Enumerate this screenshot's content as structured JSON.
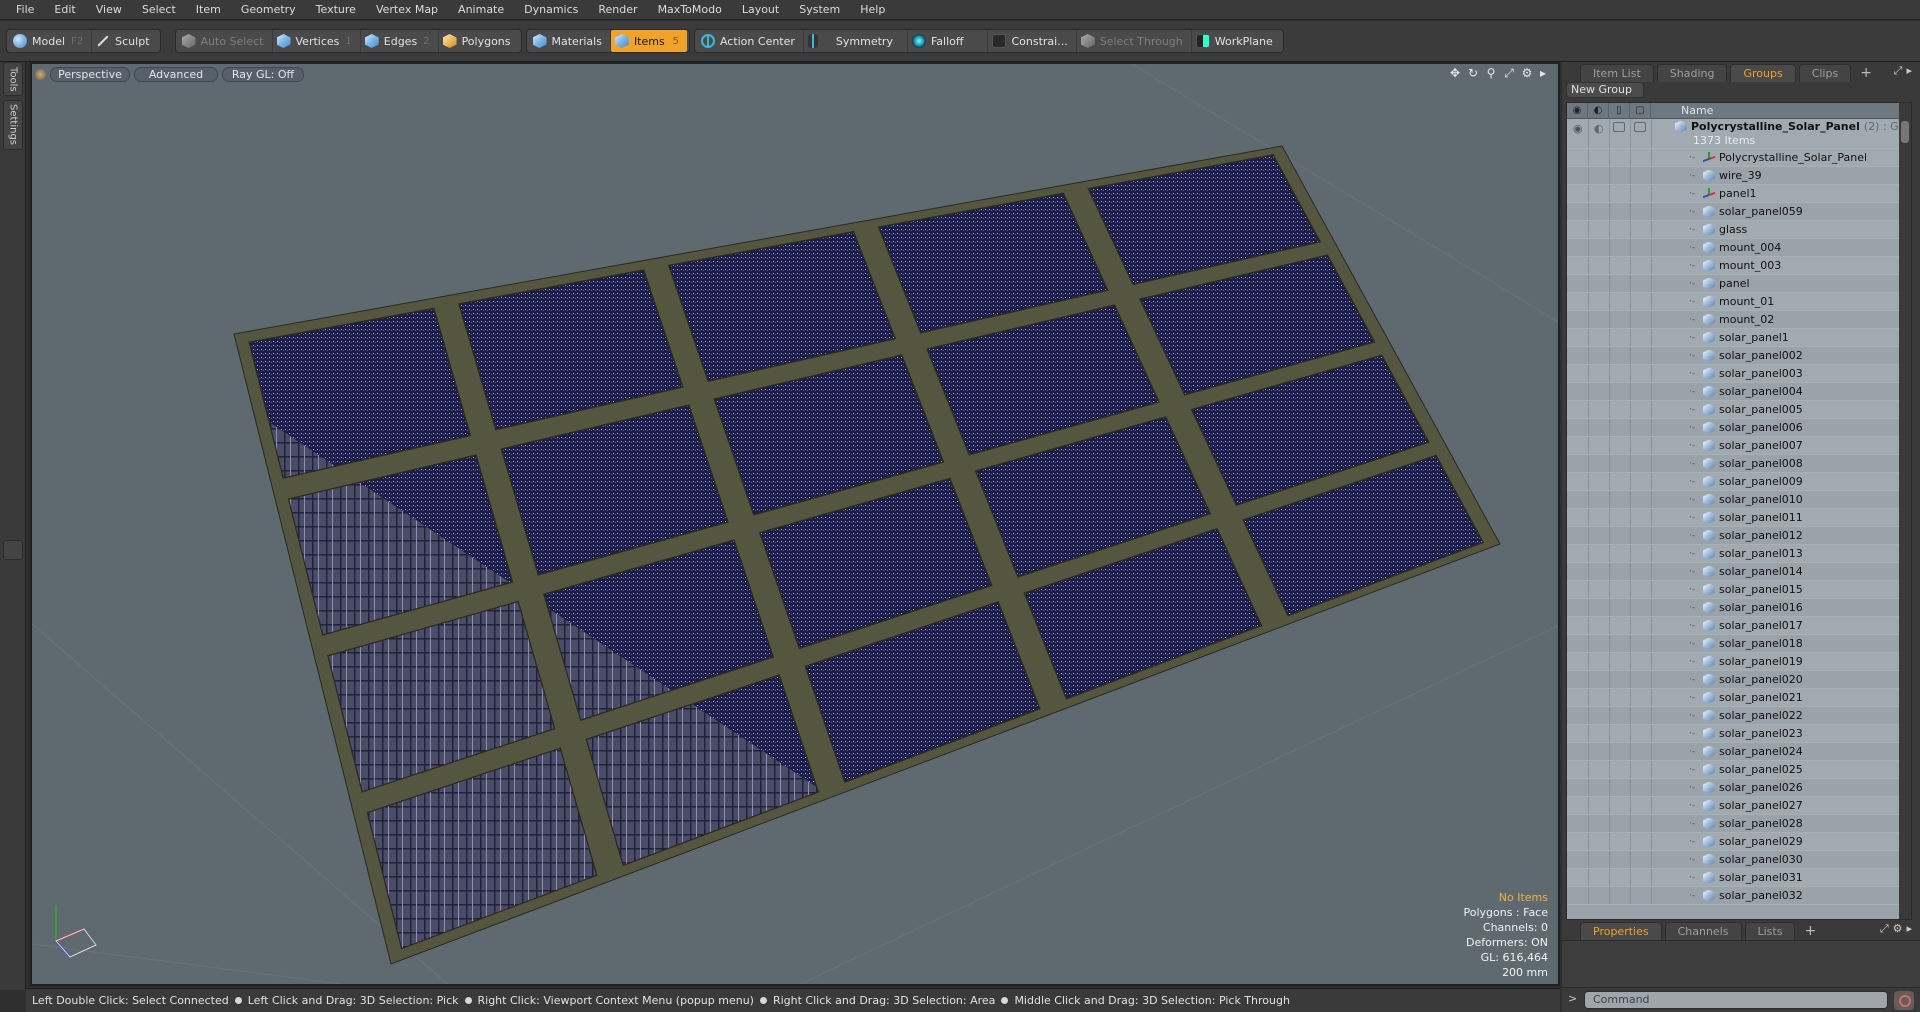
{
  "menu": [
    "File",
    "Edit",
    "View",
    "Select",
    "Item",
    "Geometry",
    "Texture",
    "Vertex Map",
    "Animate",
    "Dynamics",
    "Render",
    "MaxToModo",
    "Layout",
    "System",
    "Help"
  ],
  "toolbar": {
    "model": {
      "label": "Model",
      "key": "F2"
    },
    "sculpt": {
      "label": "Sculpt"
    },
    "auto_select": {
      "label": "Auto Select"
    },
    "vertices": {
      "label": "Vertices",
      "key": "1"
    },
    "edges": {
      "label": "Edges",
      "key": "2"
    },
    "polygons": {
      "label": "Polygons"
    },
    "materials": {
      "label": "Materials"
    },
    "items": {
      "label": "Items",
      "key": "5"
    },
    "action_center": {
      "label": "Action Center"
    },
    "symmetry": {
      "label": "Symmetry"
    },
    "falloff": {
      "label": "Falloff"
    },
    "constraints": {
      "label": "Constrai..."
    },
    "select_through": {
      "label": "Select Through"
    },
    "workplane": {
      "label": "WorkPlane"
    }
  },
  "side_tabs": {
    "tools": "Tools",
    "settings": "Settings"
  },
  "viewport": {
    "view_mode": "Perspective",
    "shading": "Advanced",
    "raygl": "Ray GL: Off",
    "accent_color": "#f0a22a",
    "panel_color": "#1c1c48",
    "info": {
      "selection": "No Items",
      "polygons": "Polygons : Face",
      "channels": "Channels: 0",
      "deformers": "Deformers: ON",
      "gl": "GL: 616,464",
      "scale": "200 mm"
    }
  },
  "status_bar": [
    "Left Double Click: Select Connected",
    "Left Click and Drag: 3D Selection: Pick",
    "Right Click: Viewport Context Menu (popup menu)",
    "Right Click and Drag: 3D Selection: Area",
    "Middle Click and Drag: 3D Selection: Pick Through"
  ],
  "right_panel": {
    "top_tabs": [
      "Item List",
      "Shading",
      "Groups",
      "Clips"
    ],
    "active_top_tab": "Groups",
    "new_group_label": "New Group",
    "column_name": "Name",
    "group": {
      "name": "Polycrystalline_Solar_Panel",
      "suffix": "(2) : G...",
      "count": "1373 Items"
    },
    "items": [
      {
        "name": "Polycrystalline_Solar_Panel",
        "type": "locator"
      },
      {
        "name": "wire_39",
        "type": "mesh"
      },
      {
        "name": "panel1",
        "type": "locator"
      },
      {
        "name": "solar_panel059",
        "type": "mesh"
      },
      {
        "name": "glass",
        "type": "mesh"
      },
      {
        "name": "mount_004",
        "type": "mesh"
      },
      {
        "name": "mount_003",
        "type": "mesh"
      },
      {
        "name": "panel",
        "type": "mesh"
      },
      {
        "name": "mount_01",
        "type": "mesh"
      },
      {
        "name": "mount_02",
        "type": "mesh"
      },
      {
        "name": "solar_panel1",
        "type": "mesh"
      },
      {
        "name": "solar_panel002",
        "type": "mesh"
      },
      {
        "name": "solar_panel003",
        "type": "mesh"
      },
      {
        "name": "solar_panel004",
        "type": "mesh"
      },
      {
        "name": "solar_panel005",
        "type": "mesh"
      },
      {
        "name": "solar_panel006",
        "type": "mesh"
      },
      {
        "name": "solar_panel007",
        "type": "mesh"
      },
      {
        "name": "solar_panel008",
        "type": "mesh"
      },
      {
        "name": "solar_panel009",
        "type": "mesh"
      },
      {
        "name": "solar_panel010",
        "type": "mesh"
      },
      {
        "name": "solar_panel011",
        "type": "mesh"
      },
      {
        "name": "solar_panel012",
        "type": "mesh"
      },
      {
        "name": "solar_panel013",
        "type": "mesh"
      },
      {
        "name": "solar_panel014",
        "type": "mesh"
      },
      {
        "name": "solar_panel015",
        "type": "mesh"
      },
      {
        "name": "solar_panel016",
        "type": "mesh"
      },
      {
        "name": "solar_panel017",
        "type": "mesh"
      },
      {
        "name": "solar_panel018",
        "type": "mesh"
      },
      {
        "name": "solar_panel019",
        "type": "mesh"
      },
      {
        "name": "solar_panel020",
        "type": "mesh"
      },
      {
        "name": "solar_panel021",
        "type": "mesh"
      },
      {
        "name": "solar_panel022",
        "type": "mesh"
      },
      {
        "name": "solar_panel023",
        "type": "mesh"
      },
      {
        "name": "solar_panel024",
        "type": "mesh"
      },
      {
        "name": "solar_panel025",
        "type": "mesh"
      },
      {
        "name": "solar_panel026",
        "type": "mesh"
      },
      {
        "name": "solar_panel027",
        "type": "mesh"
      },
      {
        "name": "solar_panel028",
        "type": "mesh"
      },
      {
        "name": "solar_panel029",
        "type": "mesh"
      },
      {
        "name": "solar_panel030",
        "type": "mesh"
      },
      {
        "name": "solar_panel031",
        "type": "mesh"
      },
      {
        "name": "solar_panel032",
        "type": "mesh"
      }
    ],
    "bottom_tabs": [
      "Properties",
      "Channels",
      "Lists"
    ],
    "active_bottom_tab": "Properties",
    "command_placeholder": "Command"
  }
}
